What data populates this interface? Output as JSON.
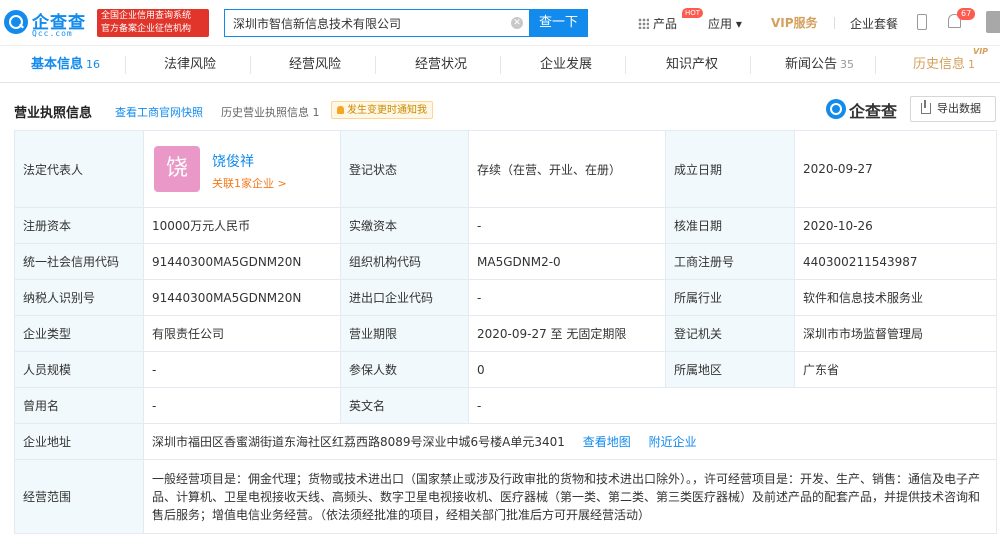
{
  "header": {
    "logo_text": "企查查",
    "logo_sub": "Qcc.com",
    "slogan_line1": "全国企业信用查询系统",
    "slogan_line2": "官方备案企业征信机构",
    "search_value": "深圳市智信新信息技术有限公司",
    "search_button": "查一下",
    "nav_products": "产品",
    "hot_badge": "HOT",
    "nav_apps": "应用 ▾",
    "nav_vip": "VIP服务",
    "nav_package": "企业套餐",
    "message_count": "67"
  },
  "tabs": [
    {
      "label": "基本信息",
      "count": "16"
    },
    {
      "label": "法律风险",
      "count": ""
    },
    {
      "label": "经营风险",
      "count": ""
    },
    {
      "label": "经营状况",
      "count": ""
    },
    {
      "label": "企业发展",
      "count": ""
    },
    {
      "label": "知识产权",
      "count": ""
    },
    {
      "label": "新闻公告",
      "count": "35"
    },
    {
      "label": "历史信息",
      "count": "1"
    }
  ],
  "tab_vip_badge": "VIP",
  "section": {
    "title": "营业执照信息",
    "link_snapshot": "查看工商官网快照",
    "history_label": "历史营业执照信息",
    "history_count": "1",
    "alert": "发生变更时通知我",
    "brand": "企查查",
    "export": "导出数据"
  },
  "info": {
    "legal_rep_label": "法定代表人",
    "legal_rep_avatar": "饶",
    "legal_rep_name": "饶俊祥",
    "legal_rep_link": "关联1家企业 >",
    "reg_status_label": "登记状态",
    "reg_status": "存续（在营、开业、在册）",
    "est_date_label": "成立日期",
    "est_date": "2020-09-27",
    "reg_capital_label": "注册资本",
    "reg_capital": "10000万元人民币",
    "paid_capital_label": "实缴资本",
    "paid_capital": "-",
    "approve_date_label": "核准日期",
    "approve_date": "2020-10-26",
    "credit_code_label": "统一社会信用代码",
    "credit_code": "91440300MA5GDNM20N",
    "org_code_label": "组织机构代码",
    "org_code": "MA5GDNM2-0",
    "biz_reg_no_label": "工商注册号",
    "biz_reg_no": "440300211543987",
    "taxpayer_id_label": "纳税人识别号",
    "taxpayer_id": "91440300MA5GDNM20N",
    "import_export_label": "进出口企业代码",
    "import_export": "-",
    "industry_label": "所属行业",
    "industry": "软件和信息技术服务业",
    "company_type_label": "企业类型",
    "company_type": "有限责任公司",
    "biz_term_label": "营业期限",
    "biz_term": "2020-09-27 至 无固定期限",
    "reg_authority_label": "登记机关",
    "reg_authority": "深圳市市场监督管理局",
    "staff_size_label": "人员规模",
    "staff_size": "-",
    "insured_label": "参保人数",
    "insured": "0",
    "region_label": "所属地区",
    "region": "广东省",
    "former_name_label": "曾用名",
    "former_name": "-",
    "english_name_label": "英文名",
    "english_name": "-",
    "address_label": "企业地址",
    "address": "深圳市福田区香蜜湖街道东海社区红荔西路8089号深业中城6号楼A单元3401",
    "address_map": "查看地图",
    "address_nearby": "附近企业",
    "scope_label": "经营范围",
    "scope": "一般经营项目是：佣金代理；货物或技术进出口（国家禁止或涉及行政审批的货物和技术进出口除外）。，许可经营项目是：开发、生产、销售：通信及电子产品、计算机、卫星电视接收天线、高频头、数字卫星电视接收机、医疗器械（第一类、第二类、第三类医疗器械）及前述产品的配套产品，并提供技术咨询和售后服务；增值电信业务经营。（依法须经批准的项目，经相关部门批准后方可开展经营活动）"
  },
  "colors": {
    "brand_blue": "#128bed",
    "label_bg": "#f2f9fc",
    "vip_gold": "#d4a05c",
    "slogan_red": "#e1342a"
  }
}
